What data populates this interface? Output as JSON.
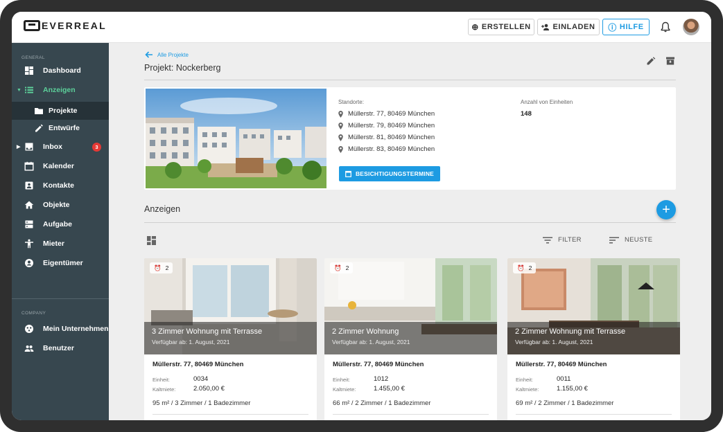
{
  "app": {
    "brand": "EVERREAL"
  },
  "topbar": {
    "create_label": "ERSTELLEN",
    "invite_label": "EINLADEN",
    "help_label": "HILFE"
  },
  "sidebar": {
    "general_label": "GENERAL",
    "company_label": "COMPANY",
    "items": [
      {
        "label": "Dashboard",
        "icon": "dashboard-icon"
      },
      {
        "label": "Anzeigen",
        "icon": "list-icon"
      },
      {
        "label": "Projekte",
        "icon": "folder-icon"
      },
      {
        "label": "Entwürfe",
        "icon": "pencil-icon"
      },
      {
        "label": "Inbox",
        "icon": "inbox-icon",
        "badge": "3"
      },
      {
        "label": "Kalender",
        "icon": "calendar-icon"
      },
      {
        "label": "Kontakte",
        "icon": "contact-icon"
      },
      {
        "label": "Objekte",
        "icon": "home-icon"
      },
      {
        "label": "Aufgabe",
        "icon": "tasks-icon"
      },
      {
        "label": "Mieter",
        "icon": "person-icon"
      },
      {
        "label": "Eigentümer",
        "icon": "account-icon"
      }
    ],
    "company_items": [
      {
        "label": "Mein Unternehmen",
        "icon": "company-icon"
      },
      {
        "label": "Benutzer",
        "icon": "users-icon"
      }
    ]
  },
  "page": {
    "back_label": "Alle Projekte",
    "title": "Projekt: Nockerberg"
  },
  "project": {
    "locations_label": "Standorte:",
    "locations": [
      "Müllerstr. 77, 80469 München",
      "Müllerstr. 79, 80469 München",
      "Müllerstr. 81, 80469 München",
      "Müllerstr. 83, 80469 München"
    ],
    "units_label": "Anzahl von Einheiten",
    "units_value": "148",
    "cta_label": "BESICHTIGUNGSTERMINE"
  },
  "listings_section": {
    "title": "Anzeigen",
    "filter_label": "FILTER",
    "sort_label": "NEUSTE"
  },
  "listings": [
    {
      "title": "3 Zimmer Wohnung mit Terrasse",
      "available": "Verfügbar ab: 1. August, 2021",
      "reminders": "2",
      "address": "Müllerstr. 77, 80469 München",
      "unit_label": "Einheit:",
      "unit": "0034",
      "rent_label": "Kaltmiete:",
      "rent": "2.050,00 €",
      "specs": "95 m² / 3 Zimmer / 1 Badezimmer"
    },
    {
      "title": "2 Zimmer Wohnung",
      "available": "Verfügbar ab: 1. August, 2021",
      "reminders": "2",
      "address": "Müllerstr. 77, 80469 München",
      "unit_label": "Einheit:",
      "unit": "1012",
      "rent_label": "Kaltmiete:",
      "rent": "1.455,00 €",
      "specs": "66 m² / 2 Zimmer / 1 Badezimmer"
    },
    {
      "title": "2 Zimmer Wohnung mit Terrasse",
      "available": "Verfügbar ab: 1. August, 2021",
      "reminders": "2",
      "address": "Müllerstr. 77, 80469 München",
      "unit_label": "Einheit:",
      "unit": "0011",
      "rent_label": "Kaltmiete:",
      "rent": "1.155,00 €",
      "specs": "69 m² / 2 Zimmer / 1 Badezimmer"
    }
  ],
  "colors": {
    "accent": "#1d9be2",
    "sidebar": "#37474f",
    "active": "#5ccf9a",
    "badge": "#e53935"
  }
}
